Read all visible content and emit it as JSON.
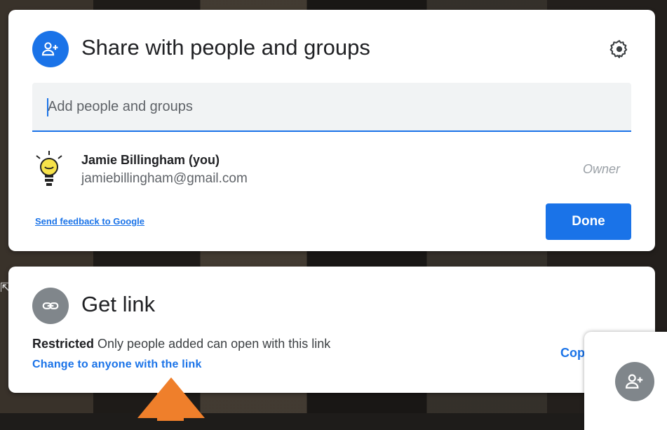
{
  "share_dialog": {
    "title": "Share with people and groups",
    "add_people_placeholder": "Add people and groups",
    "add_people_value": "",
    "person": {
      "name": "Jamie Billingham (you)",
      "email": "jamiebillingham@gmail.com",
      "role": "Owner"
    },
    "feedback_link": "Send feedback to Google",
    "done_label": "Done",
    "icons": [
      "person-add-icon",
      "gear-icon"
    ]
  },
  "link_dialog": {
    "title": "Get link",
    "status_bold": "Restricted",
    "status_text": " Only people added can open with this link",
    "change_link": "Change to anyone with the link",
    "copy_partial": "Cop",
    "icons": [
      "link-icon"
    ]
  },
  "colors": {
    "accent": "#1a73e8",
    "arrow": "#ef7f2b",
    "grey_icon": "#80868b"
  }
}
